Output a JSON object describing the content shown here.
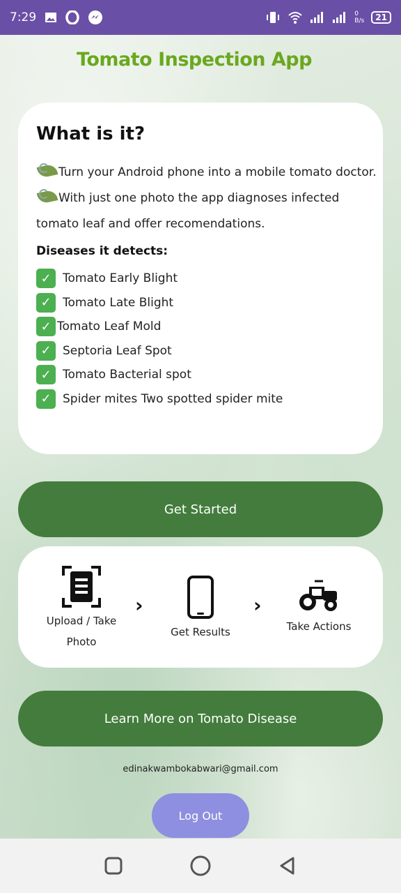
{
  "status_bar": {
    "time": "7:29",
    "network_speed": "0\nB/s",
    "battery": "21"
  },
  "app_title": "Tomato Inspection App",
  "info_card": {
    "heading": "What is it?",
    "description_lines": [
      "Turn your Android phone into a mobile tomato doctor.",
      "With just one photo the app diagnoses infected",
      "tomato leaf and offer recomendations."
    ],
    "diseases_heading": "Diseases it detects:",
    "diseases": [
      "Tomato Early Blight",
      "Tomato Late Blight",
      "Tomato Leaf Mold",
      "Septoria Leaf Spot",
      "Tomato Bacterial spot",
      "Spider mites Two spotted spider mite"
    ]
  },
  "get_started_label": "Get Started",
  "steps": {
    "upload_line1": "Upload / Take",
    "upload_line2": "Photo",
    "results": "Get Results",
    "actions": "Take Actions"
  },
  "learn_more_label": "Learn More on Tomato Disease",
  "email": "edinakwambokabwari@gmail.com",
  "logout_label": "Log Out",
  "icons": {
    "step1": "document-scan-icon",
    "step2": "smartphone-icon",
    "step3": "tractor-icon"
  },
  "colors": {
    "status_bar": "#6a4fa6",
    "title": "#6aa81f",
    "primary_button": "#437c3c",
    "logout_button": "#8e8fe0"
  }
}
